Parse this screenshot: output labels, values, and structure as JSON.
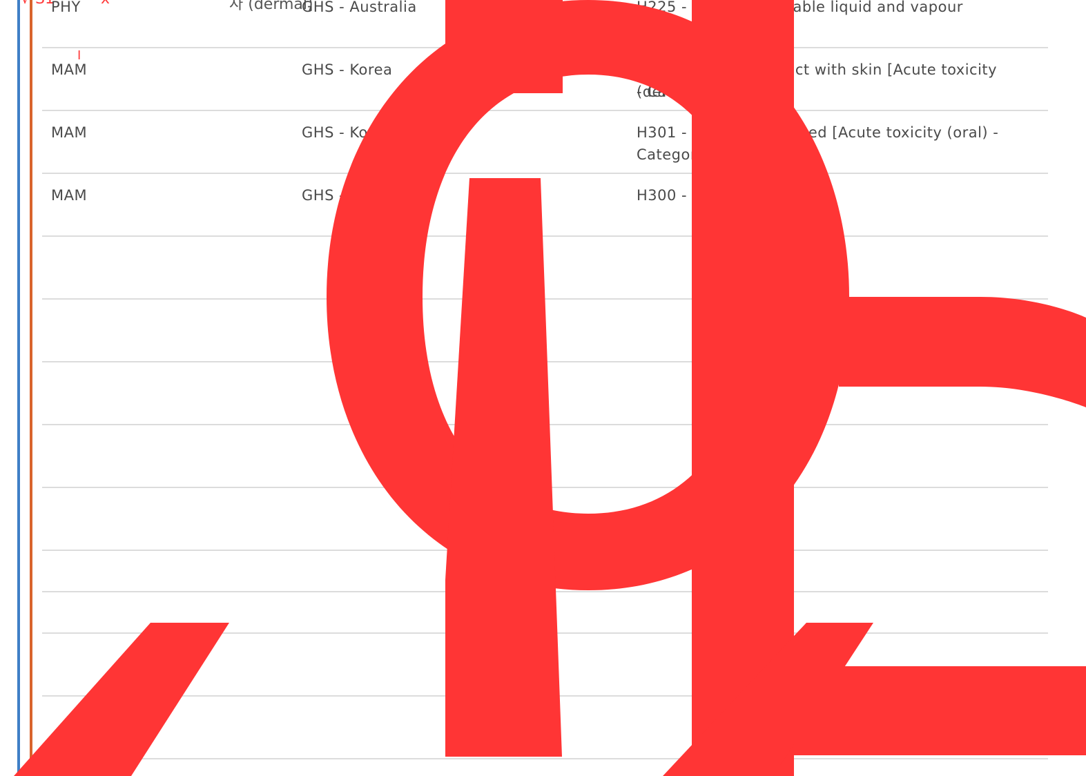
{
  "colors": {
    "accent_blue": "#3f7fc6",
    "accent_orange": "#d9642d",
    "overlay_red": "#ff3535",
    "row_border": "#dcdcdc",
    "text": "#4a4a4a"
  },
  "top_fragments": {
    "ghost_text": "자 (dermal)",
    "scribble_left": "√ S1",
    "scribble_x": "x",
    "scribble_mark": "I"
  },
  "overlay_glyphs": [
    "/",
    "d",
    "I",
    "/",
    "S"
  ],
  "rows": [
    {
      "c1": "PHY",
      "c2": "GHS - Australia",
      "c3": "H225 - Highly flammable liquid and vapour [Flammable"
    },
    {
      "c1": "MAM",
      "c2": "GHS - Korea",
      "c3": "H311 - Toxic in contact with skin [Acute toxicity (dermal)",
      "c3b": "- Category 3]"
    },
    {
      "c1": "MAM",
      "c2": "GHS - Korea",
      "c3": "H301 - Toxic if swallowed [Acute toxicity (oral) -",
      "c3b": "Category 3]"
    },
    {
      "c1": "MAM",
      "c2": "GHS - Korea",
      "c3": "H300 - Fatal if swallowed"
    }
  ]
}
